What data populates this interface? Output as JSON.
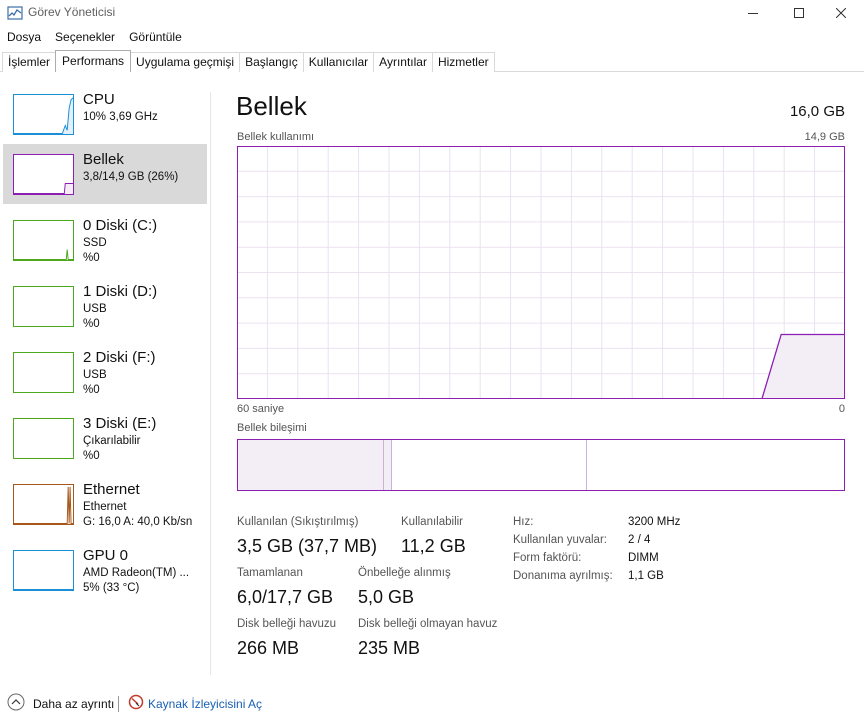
{
  "window": {
    "title": "Görev Yöneticisi"
  },
  "menu": [
    "Dosya",
    "Seçenekler",
    "Görüntüle"
  ],
  "tabs": [
    "İşlemler",
    "Performans",
    "Uygulama geçmişi",
    "Başlangıç",
    "Kullanıcılar",
    "Ayrıntılar",
    "Hizmetler"
  ],
  "active_tab": "Performans",
  "sidebar": {
    "items": [
      {
        "title": "CPU",
        "sub1": "10%  3,69 GHz",
        "sub2": "",
        "color": "#1a8ed6"
      },
      {
        "title": "Bellek",
        "sub1": "3,8/14,9 GB (26%)",
        "sub2": "",
        "color": "#8c1eb4"
      },
      {
        "title": "0 Diski (C:)",
        "sub1": "SSD",
        "sub2": "%0",
        "color": "#4da81e"
      },
      {
        "title": "1 Diski (D:)",
        "sub1": "USB",
        "sub2": "%0",
        "color": "#4da81e"
      },
      {
        "title": "2 Diski (F:)",
        "sub1": "USB",
        "sub2": "%0",
        "color": "#4da81e"
      },
      {
        "title": "3 Diski (E:)",
        "sub1": "Çıkarılabilir",
        "sub2": "%0",
        "color": "#4da81e"
      },
      {
        "title": "Ethernet",
        "sub1": "Ethernet",
        "sub2": "G: 16,0  A: 40,0 Kb/sn",
        "color": "#a7571a"
      },
      {
        "title": "GPU 0",
        "sub1": "AMD Radeon(TM) ...",
        "sub2": "5%  (33 °C)",
        "color": "#1a8ed6"
      }
    ],
    "selected_index": 1
  },
  "main": {
    "title": "Bellek",
    "total": "16,0 GB",
    "usage_label": "Bellek kullanımı",
    "usage_max": "14,9 GB",
    "time_left": "60 saniye",
    "time_right": "0",
    "composition_label": "Bellek bileşimi",
    "accent": "#8c1eb4",
    "stats": {
      "in_use_label": "Kullanılan (Sıkıştırılmış)",
      "in_use_value": "3,5 GB (37,7 MB)",
      "available_label": "Kullanılabilir",
      "available_value": "11,2 GB",
      "committed_label": "Tamamlanan",
      "committed_value": "6,0/17,7 GB",
      "cached_label": "Önbelleğe alınmış",
      "cached_value": "5,0 GB",
      "paged_label": "Disk belleği havuzu",
      "paged_value": "266 MB",
      "nonpaged_label": "Disk belleği olmayan havuz",
      "nonpaged_value": "235 MB"
    },
    "specs": [
      {
        "key": "Hız:",
        "value": "3200 MHz"
      },
      {
        "key": "Kullanılan yuvalar:",
        "value": "2 / 4"
      },
      {
        "key": "Form faktörü:",
        "value": "DIMM"
      },
      {
        "key": "Donanıma ayrılmış:",
        "value": "1,1 GB"
      }
    ]
  },
  "footer": {
    "less_details": "Daha az ayrıntı",
    "open_resmon": "Kaynak İzleyicisini Aç"
  },
  "chart_data": {
    "type": "area",
    "title": "Bellek kullanımı",
    "xlabel": "",
    "ylabel": "",
    "x_range_label": [
      "60 saniye",
      "0"
    ],
    "ylim": [
      0,
      14.9
    ],
    "unit": "GB",
    "grid": true,
    "series": [
      {
        "values_note": "",
        "x": [
          60,
          8.2,
          6.3,
          0
        ],
        "y": [
          0,
          0,
          3.8,
          3.8
        ]
      }
    ]
  }
}
